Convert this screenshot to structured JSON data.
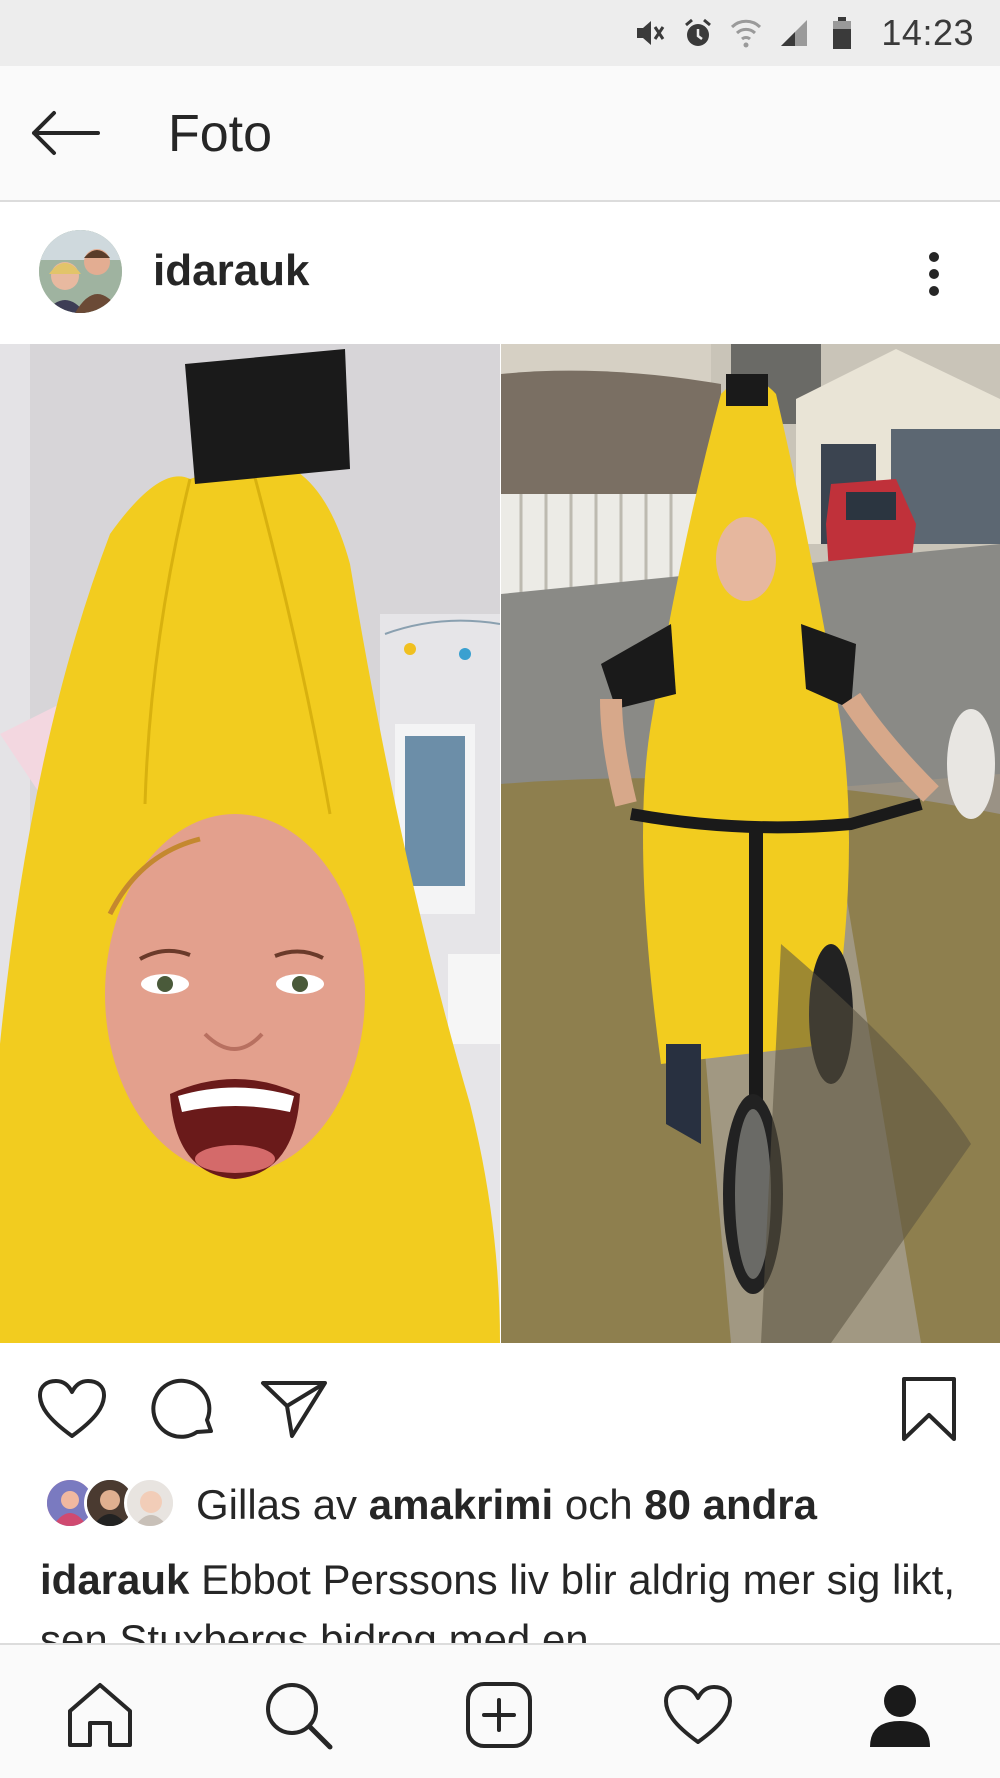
{
  "status_bar": {
    "time": "14:23",
    "icons": [
      "vibrate-icon",
      "alarm-icon",
      "wifi-icon",
      "signal-icon",
      "battery-icon"
    ]
  },
  "top_nav": {
    "title": "Foto",
    "back_icon": "back-arrow-icon"
  },
  "post": {
    "username": "idarauk",
    "more_icon": "more-vertical-icon",
    "photo": {
      "left_description_icon": "photo-woman-banana-costume",
      "right_description_icon": "photo-child-banana-costume-scooter"
    },
    "actions": {
      "like_icon": "heart-icon",
      "comment_icon": "comment-icon",
      "share_icon": "send-icon",
      "save_icon": "bookmark-icon"
    },
    "likes": {
      "prefix": "Gillas av",
      "user": "amakrimi",
      "connector": "och",
      "others": "80 andra"
    },
    "caption": {
      "username": "idarauk",
      "text": "Ebbot Perssons liv blir aldrig mer sig likt, sen Stuxbergs bidrog med en"
    }
  },
  "bottom_nav": {
    "items": [
      "home-icon",
      "search-icon",
      "add-post-icon",
      "activity-heart-icon",
      "profile-icon"
    ]
  },
  "colors": {
    "status_bar_bg": "#ededed",
    "nav_bg": "#fafafa",
    "text": "#262626",
    "banana_yellow": "#f2cc1f",
    "divider": "#dcdcdc"
  }
}
